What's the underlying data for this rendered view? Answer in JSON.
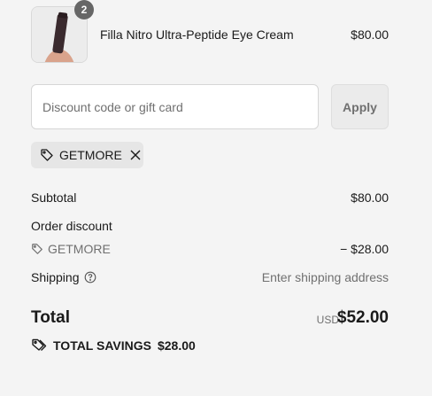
{
  "line_item": {
    "quantity": "2",
    "name": "Filla Nitro Ultra-Peptide Eye Cream",
    "price": "$80.00"
  },
  "discount": {
    "placeholder": "Discount code or gift card",
    "apply_label": "Apply",
    "applied_code": "GETMORE"
  },
  "summary": {
    "subtotal_label": "Subtotal",
    "subtotal_value": "$80.00",
    "order_discount_label": "Order discount",
    "discount_code": "GETMORE",
    "discount_value": "− $28.00",
    "shipping_label": "Shipping",
    "shipping_value": "Enter shipping address",
    "total_label": "Total",
    "currency": "USD",
    "total_value": "$52.00",
    "savings_label": "TOTAL SAVINGS",
    "savings_value": "$28.00"
  },
  "icons": {
    "tag": "tag-icon",
    "remove": "close-icon",
    "help": "question-circle-icon",
    "savings": "double-tag-icon"
  }
}
